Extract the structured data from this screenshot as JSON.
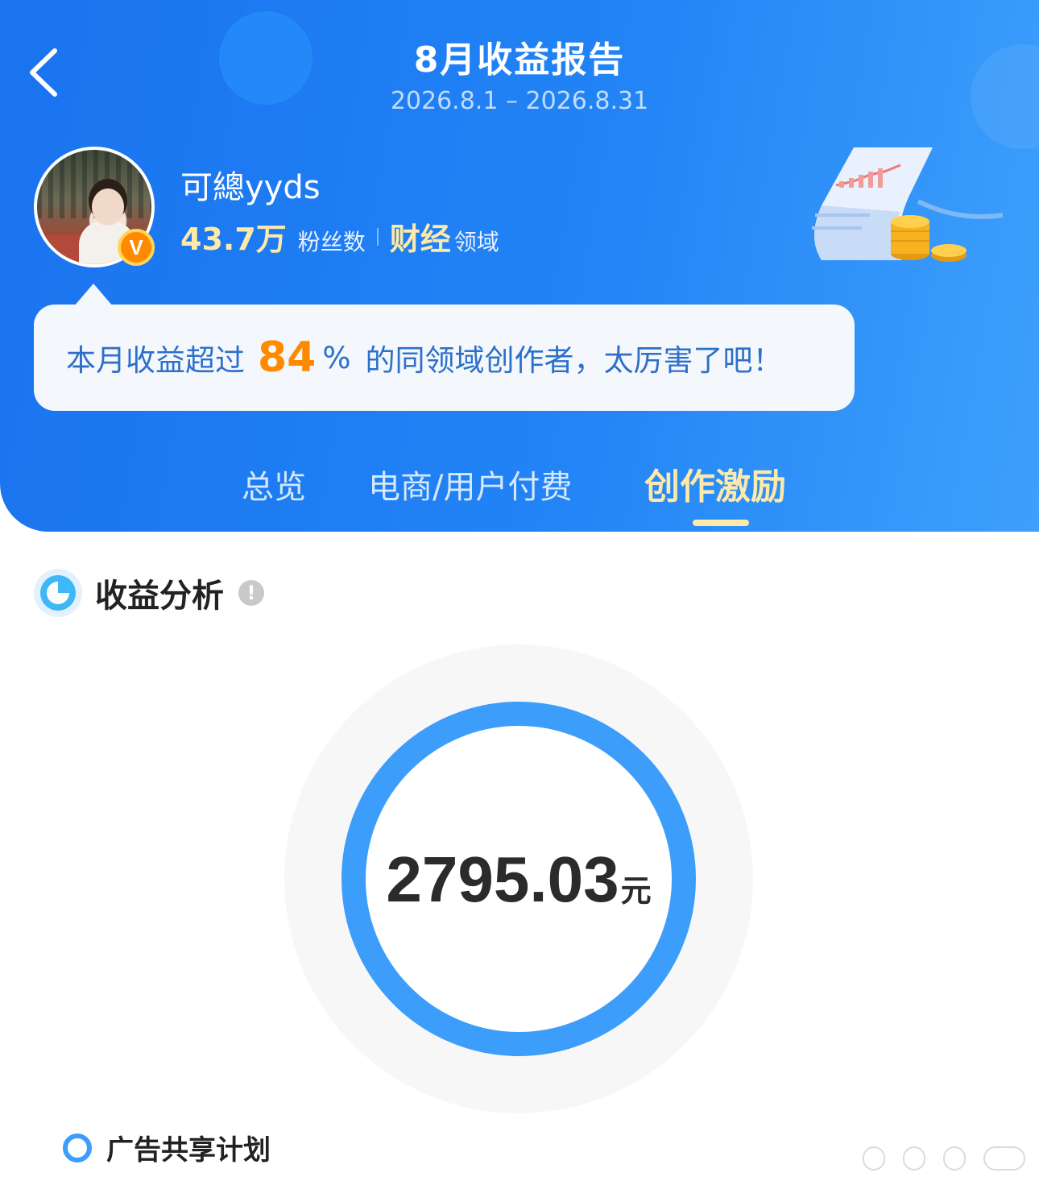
{
  "header": {
    "title": "8月收益报告",
    "date_range": "2026.8.1 – 2026.8.31"
  },
  "profile": {
    "username": "可總yyds",
    "fans_count": "43.7万",
    "fans_label": "粉丝数",
    "field_name": "财经",
    "field_label": "领域",
    "badge": "V"
  },
  "bubble": {
    "prefix": "本月收益超过",
    "percent": "84",
    "percent_sign": "%",
    "suffix": "的同领域创作者，太厉害了吧！"
  },
  "tabs": [
    {
      "label": "总览",
      "active": false
    },
    {
      "label": "电商/用户付费",
      "active": false
    },
    {
      "label": "创作激励",
      "active": true
    }
  ],
  "section": {
    "title": "收益分析",
    "info": "!"
  },
  "chart_data": {
    "type": "pie",
    "categories": [
      "广告共享计划"
    ],
    "values": [
      2795.03
    ],
    "center_value": "2795.03",
    "center_unit": "元",
    "colors": [
      "#3d9dfb"
    ]
  },
  "legend": [
    {
      "label": "广告共享计划",
      "color": "#3d9dfb"
    }
  ],
  "colors": {
    "header_blue": "#1a73ef",
    "accent_gold": "#fde9a8",
    "accent_orange": "#ff8a00",
    "ring_blue": "#3d9dfb"
  }
}
